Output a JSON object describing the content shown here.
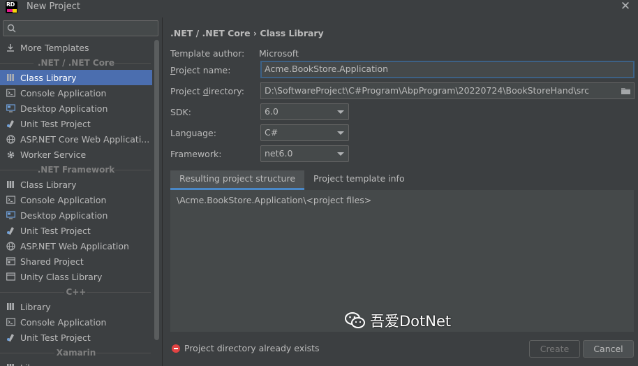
{
  "window": {
    "title": "New Project",
    "logo_text": "RD"
  },
  "left": {
    "templates": [
      {
        "kind": "item",
        "label": "More Templates",
        "icon": "download-icon"
      },
      {
        "kind": "group",
        "label": ".NET / .NET Core"
      },
      {
        "kind": "item",
        "label": "Class Library",
        "icon": "library-icon",
        "selected": true
      },
      {
        "kind": "item",
        "label": "Console Application",
        "icon": "console-icon"
      },
      {
        "kind": "item",
        "label": "Desktop Application",
        "icon": "desktop-icon"
      },
      {
        "kind": "item",
        "label": "Unit Test Project",
        "icon": "unit-test-icon"
      },
      {
        "kind": "item",
        "label": "ASP.NET Core Web Applicati...",
        "icon": "globe-icon"
      },
      {
        "kind": "item",
        "label": "Worker Service",
        "icon": "gear-icon"
      },
      {
        "kind": "group",
        "label": ".NET Framework"
      },
      {
        "kind": "item",
        "label": "Class Library",
        "icon": "library-icon"
      },
      {
        "kind": "item",
        "label": "Console Application",
        "icon": "console-icon"
      },
      {
        "kind": "item",
        "label": "Desktop Application",
        "icon": "desktop-icon"
      },
      {
        "kind": "item",
        "label": "Unit Test Project",
        "icon": "unit-test-icon"
      },
      {
        "kind": "item",
        "label": "ASP.NET Web Application",
        "icon": "globe-icon"
      },
      {
        "kind": "item",
        "label": "Shared Project",
        "icon": "shared-project-icon"
      },
      {
        "kind": "item",
        "label": "Unity Class Library",
        "icon": "unity-library-icon"
      },
      {
        "kind": "group",
        "label": "C++"
      },
      {
        "kind": "item",
        "label": "Library",
        "icon": "library-icon"
      },
      {
        "kind": "item",
        "label": "Console Application",
        "icon": "console-icon"
      },
      {
        "kind": "item",
        "label": "Unit Test Project",
        "icon": "unit-test-icon"
      },
      {
        "kind": "group",
        "label": "Xamarin"
      },
      {
        "kind": "item",
        "label": "Library",
        "icon": "library-icon"
      }
    ]
  },
  "form": {
    "breadcrumb": ".NET / .NET Core › Class Library",
    "author_label": "Template author:",
    "author_value": "Microsoft",
    "name_label_pre": "",
    "name_label_u": "P",
    "name_label_post": "roject name:",
    "name_value": "Acme.BookStore.Application",
    "dir_label_pre": "Project ",
    "dir_label_u": "d",
    "dir_label_post": "irectory:",
    "dir_value": "D:\\SoftwareProject\\C#Program\\AbpProgram\\20220724\\BookStoreHand\\src",
    "sdk_label": "SDK:",
    "sdk_value": "6.0",
    "lang_label": "Language:",
    "lang_value": "C#",
    "fw_label": "Framework:",
    "fw_value": "net6.0"
  },
  "tabs": [
    "Resulting project structure",
    "Project template info"
  ],
  "structure_text": "\\Acme.BookStore.Application\\<project files>",
  "error_text": "Project directory already exists",
  "buttons": {
    "create": "Create",
    "cancel": "Cancel"
  },
  "watermark": "吾爱DotNet",
  "colors": {
    "selection": "#4b6eaf",
    "focus": "#3d6185",
    "error": "#e34343",
    "tab_underline": "#4a88c7"
  }
}
